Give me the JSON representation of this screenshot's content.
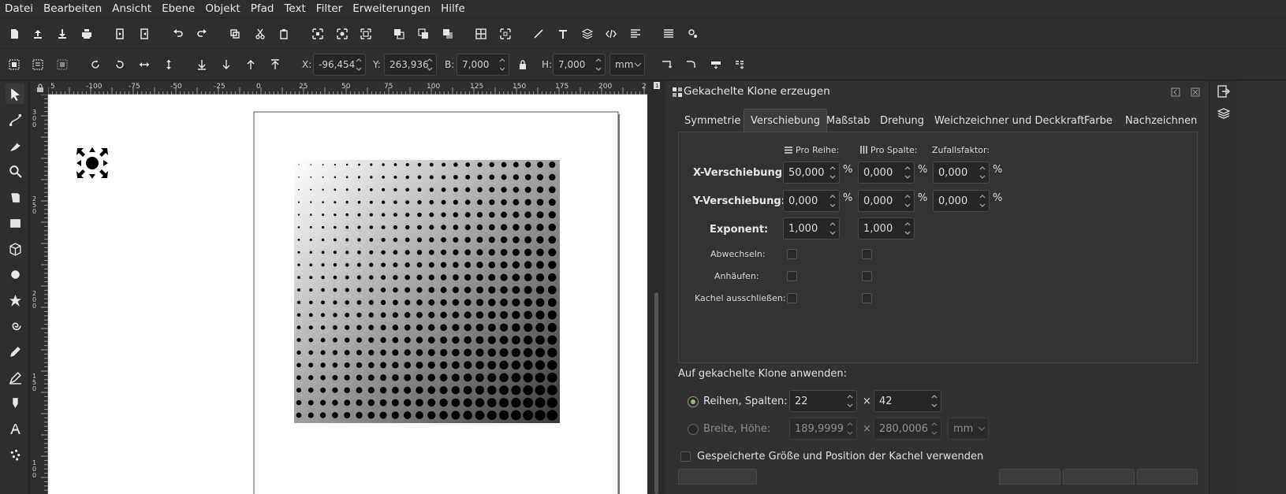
{
  "menu": [
    "Datei",
    "Bearbeiten",
    "Ansicht",
    "Ebene",
    "Objekt",
    "Pfad",
    "Text",
    "Filter",
    "Erweiterungen",
    "Hilfe"
  ],
  "command_bar_icons": [
    "new-document-icon",
    "open-icon",
    "import-icon",
    "print-icon",
    "import-file-icon",
    "export-icon",
    "undo-icon",
    "redo-icon",
    "duplicate-icon",
    "cut-icon",
    "paste-icon",
    "zoom-selection-icon",
    "zoom-drawing-icon",
    "zoom-page-icon",
    "group-icon",
    "ungroup-icon",
    "clone-icon",
    "select-same-icon",
    "unlink-clone-icon",
    "xml-editor-icon",
    "text-font-icon",
    "layers-icon",
    "html-icon",
    "align-icon",
    "objects-icon",
    "preferences-icon"
  ],
  "controls": {
    "x_label": "X:",
    "x_value": "-96,454",
    "y_label": "Y:",
    "y_value": "263,936",
    "w_label": "B:",
    "w_value": "7,000",
    "h_label": "H:",
    "h_value": "7,000",
    "unit": "mm"
  },
  "ruler_top": [
    "5",
    "-100",
    "-75",
    "-50",
    "-25",
    "0",
    "25",
    "50",
    "75",
    "100",
    "125",
    "150",
    "175",
    "200",
    "2"
  ],
  "ruler_left": [
    "3",
    "0",
    "0",
    "2",
    "5",
    "0",
    "2",
    "0",
    "0",
    "1",
    "5",
    "0",
    "1",
    "0",
    "0"
  ],
  "dialog": {
    "title": "Gekachelte Klone erzeugen",
    "tabs": [
      "Symmetrie",
      "Verschiebung",
      "Maßstab",
      "Drehung",
      "Weichzeichner und Deckkraft",
      "Farbe",
      "Nachzeichnen"
    ],
    "active_tab": "Verschiebung",
    "col_headers": {
      "row": "Pro Reihe:",
      "col": "Pro Spalte:",
      "rand": "Zufallsfaktor:"
    },
    "rows": [
      {
        "label": "X-Verschiebung:",
        "row": "50,000",
        "col": "0,000",
        "rand": "0,000"
      },
      {
        "label": "Y-Verschiebung:",
        "row": "0,000",
        "col": "0,000",
        "rand": "0,000"
      },
      {
        "label": "Exponent:",
        "row": "1,000",
        "col": "1,000"
      }
    ],
    "percent": "%",
    "checks": [
      "Abwechseln:",
      "Anhäufen:",
      "Kachel ausschließen:"
    ],
    "apply_title": "Auf gekachelte Klone anwenden:",
    "rows_cols": {
      "label": "Reihen, Spalten:",
      "rows": "22",
      "cols": "42"
    },
    "width_height": {
      "label": "Breite, Höhe:",
      "width": "189,9999",
      "height": "280,0006",
      "unit": "mm"
    },
    "times": "×",
    "saved_size_label": "Gespeicherte Größe und Position der Kachel verwenden"
  }
}
